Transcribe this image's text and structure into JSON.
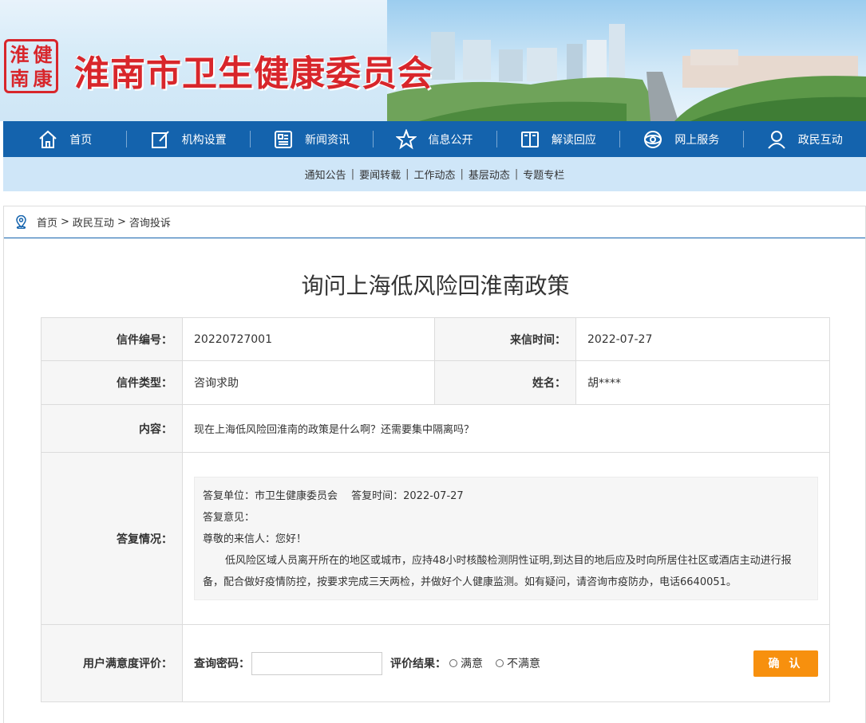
{
  "site": {
    "title": "淮南市卫生健康委员会",
    "seal_chars": [
      "淮",
      "健",
      "南",
      "康"
    ]
  },
  "nav": [
    {
      "label": "首页",
      "icon": "home-icon"
    },
    {
      "label": "机构设置",
      "icon": "edit-icon"
    },
    {
      "label": "新闻资讯",
      "icon": "news-icon"
    },
    {
      "label": "信息公开",
      "icon": "star-icon"
    },
    {
      "label": "解读回应",
      "icon": "book-icon"
    },
    {
      "label": "网上服务",
      "icon": "globe-icon"
    },
    {
      "label": "政民互动",
      "icon": "user-icon"
    }
  ],
  "subnav": [
    "通知公告",
    "要闻转载",
    "工作动态",
    "基层动态",
    "专题专栏"
  ],
  "breadcrumb": {
    "home": "首页",
    "sep": ">",
    "section": "政民互动",
    "current": "咨询投诉"
  },
  "letter": {
    "title": "询问上海低风险回淮南政策",
    "no_label": "信件编号：",
    "no_value": "20220727001",
    "time_label": "来信时间：",
    "time_value": "2022-07-27",
    "type_label": "信件类型：",
    "type_value": "咨询求助",
    "name_label": "姓名：",
    "name_value": "胡****",
    "content_label": "内容：",
    "content_value": "现在上海低风险回淮南的政策是什么啊？还需要集中隔离吗？",
    "reply_label": "答复情况：",
    "reply": {
      "unit_line": "答复单位：市卫生健康委员会　 答复时间：2022-07-27",
      "opinion_label": "答复意见：",
      "greeting": "尊敬的来信人：您好！",
      "body": "低风险区域人员离开所在的地区或城市，应持48小时核酸检测阴性证明,到达目的地后应及时向所居住社区或酒店主动进行报备，配合做好疫情防控，按要求完成三天两检，并做好个人健康监测。如有疑问，请咨询市疫防办，电话6640051。"
    }
  },
  "evaluation": {
    "label": "用户满意度评价：",
    "pwd_label": "查询密码：",
    "pwd_value": "",
    "result_label": "评价结果：",
    "options": [
      "满意",
      "不满意"
    ],
    "confirm": "确 认"
  },
  "colors": {
    "nav": "#1463ad",
    "subnav": "#cfe6f8",
    "title_red": "#d8262b",
    "button": "#f7900e"
  }
}
